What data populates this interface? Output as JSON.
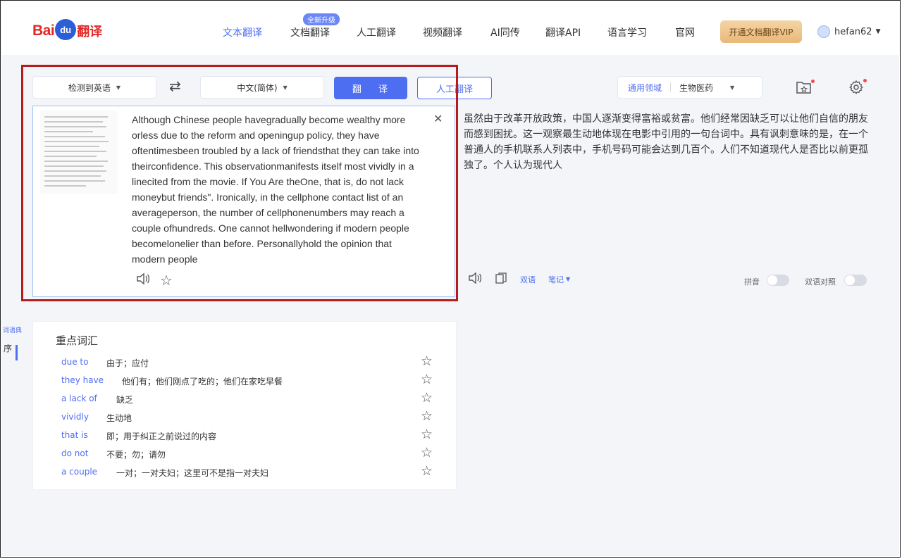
{
  "header": {
    "logo": {
      "bai": "Bai",
      "du": "du",
      "fanyi": "翻译"
    },
    "nav": [
      {
        "label": "文本翻译",
        "active": true
      },
      {
        "label": "文档翻译",
        "badge": "全新升级"
      },
      {
        "label": "人工翻译"
      },
      {
        "label": "视频翻译"
      },
      {
        "label": "AI同传"
      },
      {
        "label": "翻译API"
      },
      {
        "label": "语言学习"
      },
      {
        "label": "官网"
      }
    ],
    "vip_button": "开通文档翻译VIP",
    "username": "hefan62"
  },
  "toolbar": {
    "source_language": "检测到英语",
    "target_language": "中文(简体)",
    "translate_button": "翻 译",
    "human_button": "人工翻译",
    "domain_label": "通用领域",
    "domain_value": "生物医药"
  },
  "source": {
    "text": "Although Chinese people havegradually become wealthy more orless due to the reform and openingup policy, they have oftentimesbeen troubled by a lack of friendsthat they can take into theirconfidence. This observationmanifests itself most vividly in a linecited from the movie. If You Are theOne, that is, do not lack moneybut friends\". Ironically, in the cellphone contact list of an averageperson, the number of cellphonenumbers may reach a couple ofhundreds. One cannot hellwondering if modern people becomelonelier than before. Personallyhold the opinion that modern people"
  },
  "target": {
    "text": "虽然由于改革开放政策，中国人逐渐变得富裕或贫富。他们经常因缺乏可以让他们自信的朋友而感到困扰。这一观察最生动地体现在电影中引用的一句台词中。具有讽刺意味的是，在一个普通人的手机联系人列表中，手机号码可能会达到几百个。人们不知道现代人是否比以前更孤独了。个人认为现代人",
    "tools": {
      "double_example": "双语",
      "notes": "笔记"
    },
    "toggle_pinyin": "拼音",
    "toggle_compare": "双语对照"
  },
  "left_edge": {
    "tag": "词语典",
    "char": "序"
  },
  "vocab": {
    "title": "重点词汇",
    "items": [
      {
        "word": "due to",
        "meaning": "由于；应付"
      },
      {
        "word": "they have",
        "meaning": "他们有；他们刚点了吃的；他们在家吃早餐"
      },
      {
        "word": "a lack of",
        "meaning": "缺乏"
      },
      {
        "word": "vividly",
        "meaning": "生动地"
      },
      {
        "word": "that is",
        "meaning": "即；用于纠正之前说过的内容"
      },
      {
        "word": "do not",
        "meaning": "不要；勿；请勿"
      },
      {
        "word": "a couple",
        "meaning": "一对；一对夫妇；这里可不是指一对夫妇"
      }
    ]
  },
  "colors": {
    "accent": "#4e6ef2",
    "brand_red": "#e02a28",
    "highlight_border": "#b81b1b"
  }
}
